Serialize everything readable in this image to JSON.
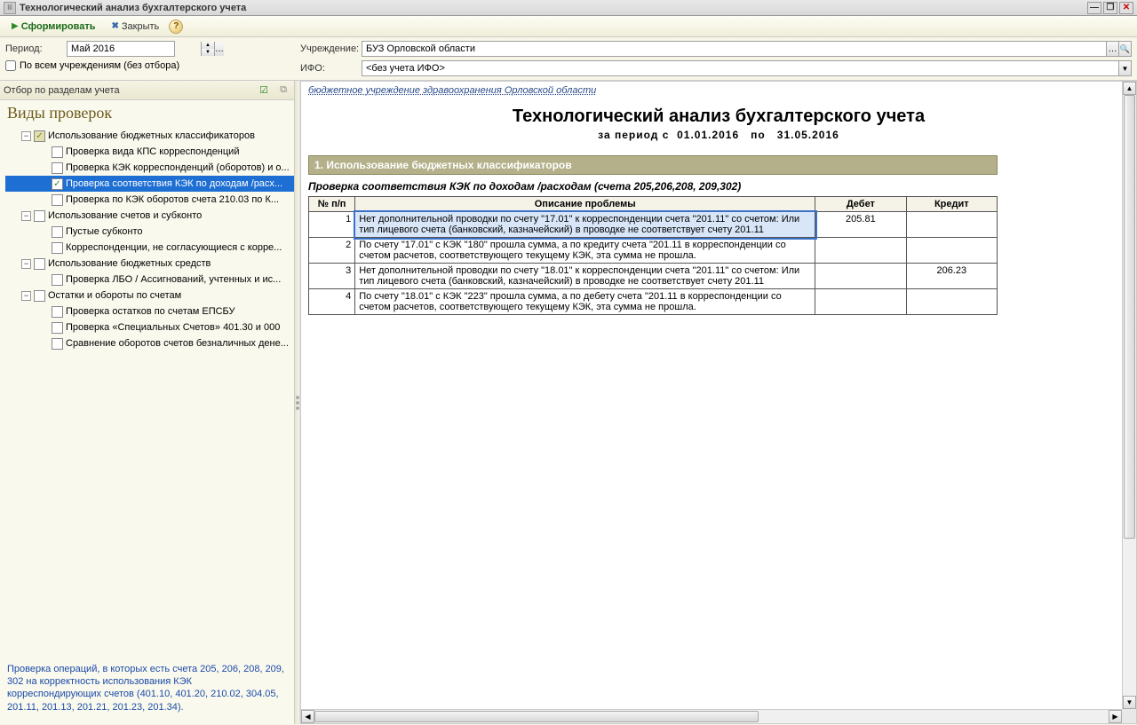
{
  "window": {
    "title": "Технологический анализ бухгалтерского учета"
  },
  "toolbar": {
    "generate": "Сформировать",
    "close": "Закрыть"
  },
  "filters": {
    "period_label": "Период:",
    "period_value": "Май 2016",
    "all_orgs_label": "По всем учреждениям (без отбора)",
    "org_label": "Учреждение:",
    "org_value": "БУЗ Орловской области",
    "ifo_label": "ИФО:",
    "ifo_value": "<без учета ИФО>"
  },
  "sidebar": {
    "toolbar_label": "Отбор по разделам учета",
    "title": "Виды проверок",
    "groups": [
      {
        "label": "Использование бюджетных классификаторов",
        "partial": true,
        "children": [
          {
            "label": "Проверка вида КПС корреспонденций",
            "checked": false
          },
          {
            "label": "Проверка КЭК корреспонденций (оборотов) и о...",
            "checked": false
          },
          {
            "label": "Проверка соответствия КЭК по доходам /расх...",
            "checked": true,
            "selected": true
          },
          {
            "label": "Проверка по КЭК оборотов счета 210.03 по К...",
            "checked": false
          }
        ]
      },
      {
        "label": "Использование счетов и субконто",
        "children": [
          {
            "label": "Пустые субконто",
            "checked": false
          },
          {
            "label": "Корреспонденции, не согласующиеся с корре...",
            "checked": false
          }
        ]
      },
      {
        "label": "Использование бюджетных средств",
        "children": [
          {
            "label": "Проверка ЛБО / Ассигнований, учтенных и ис...",
            "checked": false
          }
        ]
      },
      {
        "label": "Остатки и обороты по счетам",
        "children": [
          {
            "label": "Проверка остатков по счетам ЕПСБУ",
            "checked": false
          },
          {
            "label": "Проверка «Специальных Счетов» 401.30 и 000",
            "checked": false
          },
          {
            "label": "Сравнение оборотов счетов безналичных дене...",
            "checked": false
          }
        ]
      }
    ],
    "footer": "Проверка операций, в которых есть счета 205, 206, 208, 209, 302 на корректность использования КЭК корреспондирующих счетов (401.10, 401.20, 210.02, 304.05, 201.11, 201.13, 201.21, 201.23, 201.34)."
  },
  "report": {
    "org_line": "бюджетное учреждение здравоохранения Орловской области",
    "title": "Технологический анализ бухгалтерского учета",
    "period_prefix": "за период с",
    "period_from": "01.01.2016",
    "period_sep": "по",
    "period_to": "31.05.2016",
    "section_head": "1. Использование бюджетных классификаторов",
    "check_title": "Проверка соответствия КЭК по доходам /расходам (счета 205,206,208, 209,302)",
    "columns": {
      "n": "№ п/п",
      "desc": "Описание проблемы",
      "debit": "Дебет",
      "credit": "Кредит"
    },
    "rows": [
      {
        "n": "1",
        "desc": "Нет дополнительной проводки по счету \"17.01\" к корреспонденции счета \"201.11\" со счетом: Или тип лицевого счета (банковский, казначейский) в проводке не соответствует счету 201.11",
        "debit": "205.81",
        "credit": ""
      },
      {
        "n": "2",
        "desc": "По счету \"17.01\" с КЭК \"180\" прошла сумма, а по кредиту счета \"201.11 в корреспонденции со счетом расчетов, соответствующего текущему КЭК, эта сумма не прошла.",
        "debit": "",
        "credit": ""
      },
      {
        "n": "3",
        "desc": "Нет дополнительной проводки по счету \"18.01\" к корреспонденции счета \"201.11\" со счетом: Или тип лицевого счета (банковский, казначейский) в проводке не соответствует счету 201.11",
        "debit": "",
        "credit": "206.23"
      },
      {
        "n": "4",
        "desc": "По счету \"18.01\" с КЭК \"223\" прошла сумма, а по дебету счета \"201.11 в корреспонденции со счетом расчетов, соответствующего текущему КЭК, эта сумма не прошла.",
        "debit": "",
        "credit": ""
      }
    ]
  }
}
